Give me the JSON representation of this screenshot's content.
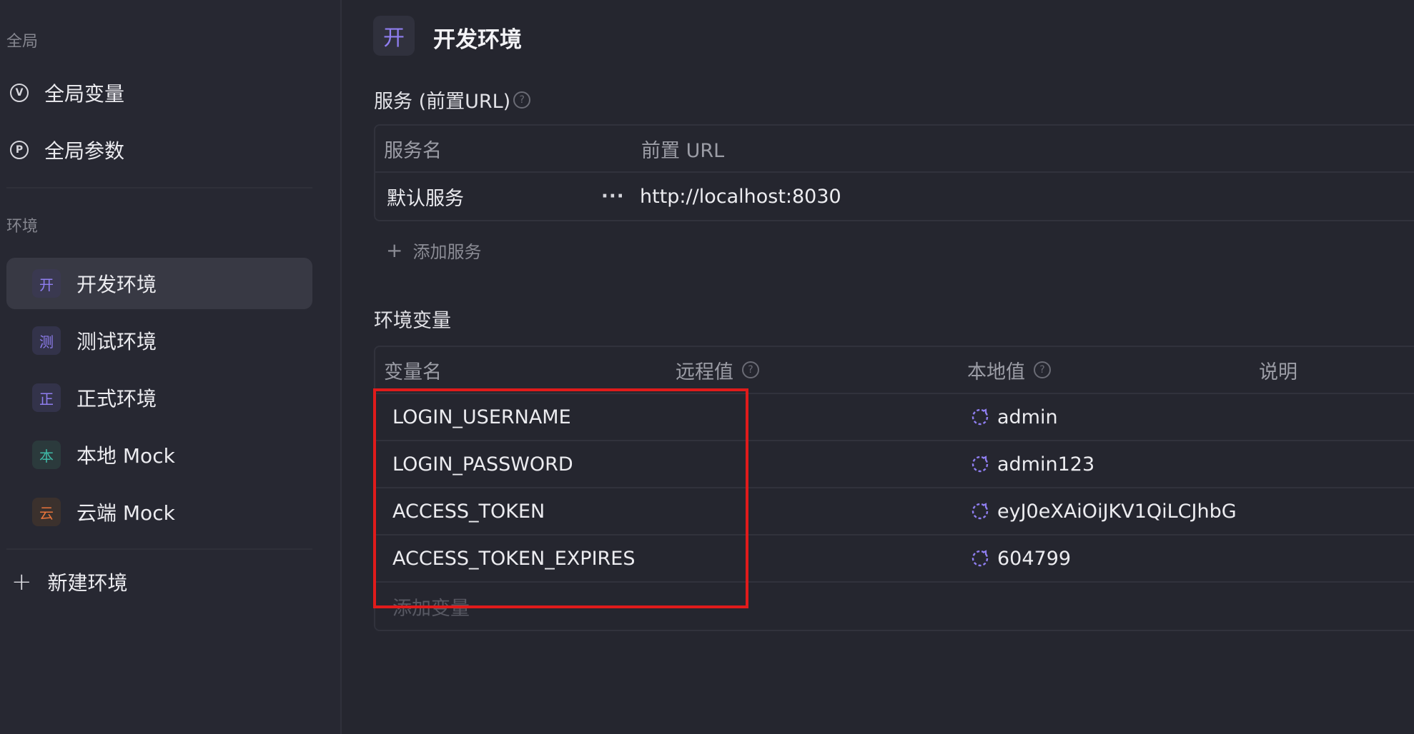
{
  "sidebar": {
    "global_section": "全局",
    "global_items": [
      {
        "icon": "V",
        "label": "全局变量"
      },
      {
        "icon": "P",
        "label": "全局参数"
      }
    ],
    "env_section": "环境",
    "envs": [
      {
        "badge": "开",
        "label": "开发环境",
        "color": "#8f7ef0",
        "bg": "#3a3950",
        "active": true
      },
      {
        "badge": "测",
        "label": "测试环境",
        "color": "#8f7ef0",
        "bg": "#33334a",
        "active": false
      },
      {
        "badge": "正",
        "label": "正式环境",
        "color": "#8f7ef0",
        "bg": "#33334a",
        "active": false
      },
      {
        "badge": "本",
        "label": "本地 Mock",
        "color": "#3fb8a6",
        "bg": "#2b3a3c",
        "active": false
      },
      {
        "badge": "云",
        "label": "云端 Mock",
        "color": "#e8743b",
        "bg": "#3b312d",
        "active": false
      }
    ],
    "new_env_label": "新建环境"
  },
  "header": {
    "badge": "开",
    "title": "开发环境"
  },
  "services": {
    "title": "服务 (前置URL)",
    "help_icon": "?",
    "columns": [
      "服务名",
      "前置 URL"
    ],
    "rows": [
      {
        "name": "默认服务",
        "more": "···",
        "url": "http://localhost:8030"
      }
    ],
    "add_label": "添加服务"
  },
  "env_vars": {
    "title": "环境变量",
    "columns": {
      "name": "变量名",
      "remote": "远程值",
      "local": "本地值",
      "desc": "说明"
    },
    "help_icon": "?",
    "rows": [
      {
        "name": "LOGIN_USERNAME",
        "remote": "",
        "local": "admin",
        "desc": ""
      },
      {
        "name": "LOGIN_PASSWORD",
        "remote": "",
        "local": "admin123",
        "desc": ""
      },
      {
        "name": "ACCESS_TOKEN",
        "remote": "",
        "local": "eyJ0eXAiOiJKV1QiLCJhbG",
        "desc": ""
      },
      {
        "name": "ACCESS_TOKEN_EXPIRES",
        "remote": "",
        "local": "604799",
        "desc": ""
      }
    ],
    "add_placeholder": "添加变量"
  },
  "colors": {
    "accent": "#8f7ef0",
    "highlight": "#e01b1b",
    "background": "#25262f"
  }
}
